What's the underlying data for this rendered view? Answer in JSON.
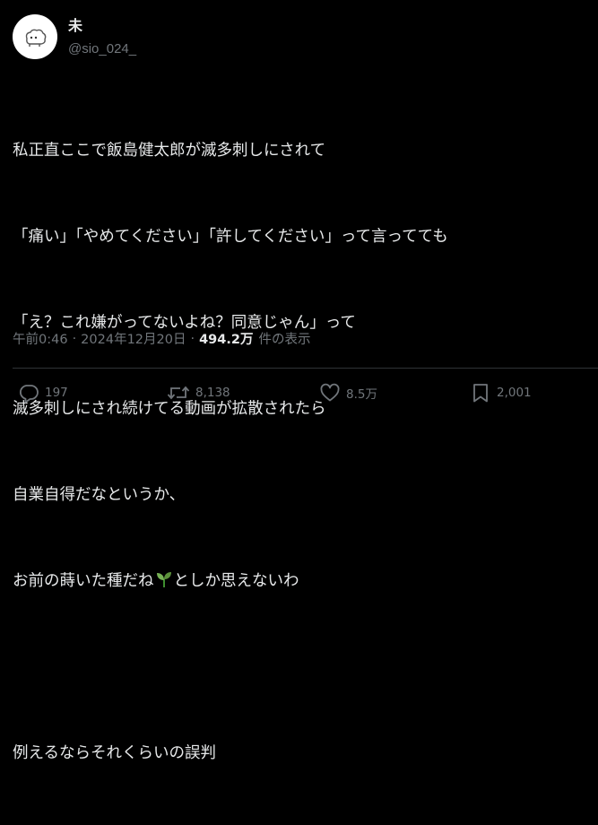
{
  "user": {
    "display_name": "未",
    "handle": "@sio_024_"
  },
  "tweet": {
    "lines": [
      "私正直ここで飯島健太郎が滅多刺しにされて",
      "「痛い」「やめてください」「許してください」って言ってても",
      "「え？これ嫌がってないよね？同意じゃん」って",
      "滅多刺しにされ続けてる動画が拡散されたら",
      "自業自得だなというか、",
      "お前の蒔いた種だね",
      "としか思えないわ",
      "",
      "例えるならそれくらいの誤判"
    ],
    "emoji": "seedling-icon"
  },
  "meta": {
    "time": "午前0:46",
    "separator": "·",
    "date": "2024年12月20日",
    "views_count": "494.2万",
    "views_label": "件の表示"
  },
  "actions": {
    "replies": "197",
    "reposts": "8,138",
    "likes": "8.5万",
    "bookmarks": "2,001"
  },
  "colors": {
    "background": "#000000",
    "text": "#e7e9ea",
    "muted": "#71767b",
    "divider": "#2f3336"
  }
}
